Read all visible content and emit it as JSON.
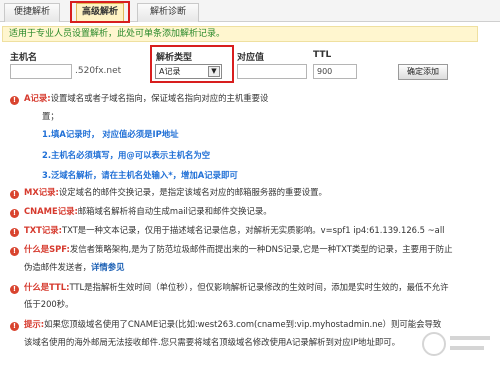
{
  "tabs": [
    {
      "label": "便捷解析"
    },
    {
      "label": "高级解析"
    },
    {
      "label": "解析诊断"
    }
  ],
  "notice": "适用于专业人员设置解析，此处可单条添加解析记录。",
  "form": {
    "host_label": "主机名",
    "type_label": "解析类型",
    "value_label": "对应值",
    "ttl_label": "TTL",
    "host_suffix": ".520fx.net",
    "type_value": "A记录",
    "ttl_value": "900",
    "submit_label": "确定添加"
  },
  "info": {
    "a_key": "A记录:",
    "a_text": "设置域名或者子域名指向，保证域名指向对应的主机重要设",
    "a_text2": "置；",
    "a_rule1": "1.填A记录时， 对应值必须是IP地址",
    "a_rule2": "2.主机名必须填写，用@可以表示主机名为空",
    "a_rule3": "3.泛域名解析，请在主机名处输入*，增加A记录即可",
    "mx_key": "MX记录:",
    "mx_text": "设定域名的邮件交换记录，是指定该域名对应的邮箱服务器的重要设置。",
    "cname_key": "CNAME记录:",
    "cname_text": "邮箱域名解析将自动生成mail记录和邮件交换记录。",
    "txt_key": "TXT记录:",
    "txt_text": "TXT是一种文本记录，仅用于描述域名记录信息，对解析无实质影响。v=spf1 ip4:61.139.126.5 ~all",
    "spf_key": "什么是SPF:",
    "spf_text": "发信者策略架构,是为了防范垃圾邮件而提出来的一种DNS记录,它是一种TXT类型的记录，主要用于防止",
    "spf_text2": "伪造邮件发送者，",
    "spf_link": "详情参见",
    "ttl_key": "什么是TTL:",
    "ttl_text": "TTL是指解析生效时间（单位秒），但仅影响解析记录修改的生效时间，添加是实时生效的，最低不允许",
    "ttl_text2": "低于200秒。",
    "tip_key": "提示:",
    "tip_text": "如果您顶级域名使用了CNAME记录(比如:west263.com(cname到:vip.myhostadmin.ne",
    "tip_text_end": "）则可能会导致",
    "tip_text2": "该域名使用的海外邮局无法接收邮件.您只需要将域名顶级域名修改使用A记录解析到对应IP地址即可。"
  },
  "colors": {
    "accent_red": "#d81e1e",
    "key_red": "#d63a2e",
    "rule_blue": "#1f6fd6",
    "notice_green": "#2b8a2b",
    "notice_bg": "#fff6cf"
  },
  "icons": {
    "bullet": "exclamation-bullet-icon",
    "dropdown": "chevron-down-icon",
    "watermark": "watermark-logo"
  }
}
